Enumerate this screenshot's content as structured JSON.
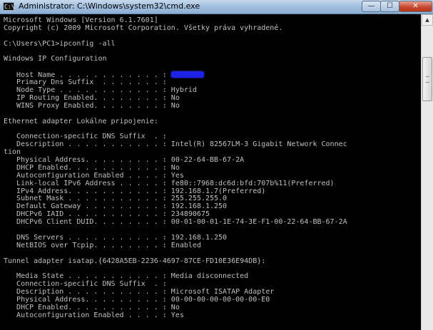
{
  "window": {
    "title": "Administrator: C:\\Windows\\system32\\cmd.exe",
    "icon_text": "C:\\",
    "buttons": {
      "minimize": "—",
      "maximize": "☐",
      "close": "✕"
    }
  },
  "console": {
    "colors": {
      "background": "#000000",
      "text": "#c0c0c0",
      "redaction": "#1e22e6"
    },
    "lines": [
      "Microsoft Windows [Version 6.1.7601]",
      "Copyright (c) 2009 Microsoft Corporation. Všetky práva vyhradené.",
      "",
      "C:\\Users\\PC1>ipconfig -all",
      "",
      "Windows IP Configuration",
      "",
      "   Host Name . . . . . . . . . . . . : ",
      "   Primary Dns Suffix  . . . . . . . : ",
      "   Node Type . . . . . . . . . . . . : Hybrid",
      "   IP Routing Enabled. . . . . . . . : No",
      "   WINS Proxy Enabled. . . . . . . . : No",
      "",
      "Ethernet adapter Lokálne pripojenie:",
      "",
      "   Connection-specific DNS Suffix  . :",
      "   Description . . . . . . . . . . . : Intel(R) 82567LM-3 Gigabit Network Connec",
      "tion",
      "   Physical Address. . . . . . . . . : 00-22-64-BB-67-2A",
      "   DHCP Enabled. . . . . . . . . . . : No",
      "   Autoconfiguration Enabled . . . . : Yes",
      "   Link-local IPv6 Address . . . . . : fe80::7968:dc6d:bfd:707b%11(Preferred)",
      "   IPv4 Address. . . . . . . . . . . : 192.168.1.7(Preferred)",
      "   Subnet Mask . . . . . . . . . . . : 255.255.255.0",
      "   Default Gateway . . . . . . . . . : 192.168.1.250",
      "   DHCPv6 IAID . . . . . . . . . . . : 234890675",
      "   DHCPv6 Client DUID. . . . . . . . : 00-01-00-01-1E-74-3E-F1-00-22-64-BB-67-2A",
      "",
      "   DNS Servers . . . . . . . . . . . : 192.168.1.250",
      "   NetBIOS over Tcpip. . . . . . . . : Enabled",
      "",
      "Tunnel adapter isatap.{6428A5EB-2236-4697-87CE-FD10E36E94DB}:",
      "",
      "   Media State . . . . . . . . . . . : Media disconnected",
      "   Connection-specific DNS Suffix  . :",
      "   Description . . . . . . . . . . . : Microsoft ISATAP Adapter",
      "   Physical Address. . . . . . . . . : 00-00-00-00-00-00-00-E0",
      "   DHCP Enabled. . . . . . . . . . . : No",
      "   Autoconfiguration Enabled . . . . : Yes"
    ]
  },
  "scrollbar": {
    "up_arrow": "▲"
  }
}
